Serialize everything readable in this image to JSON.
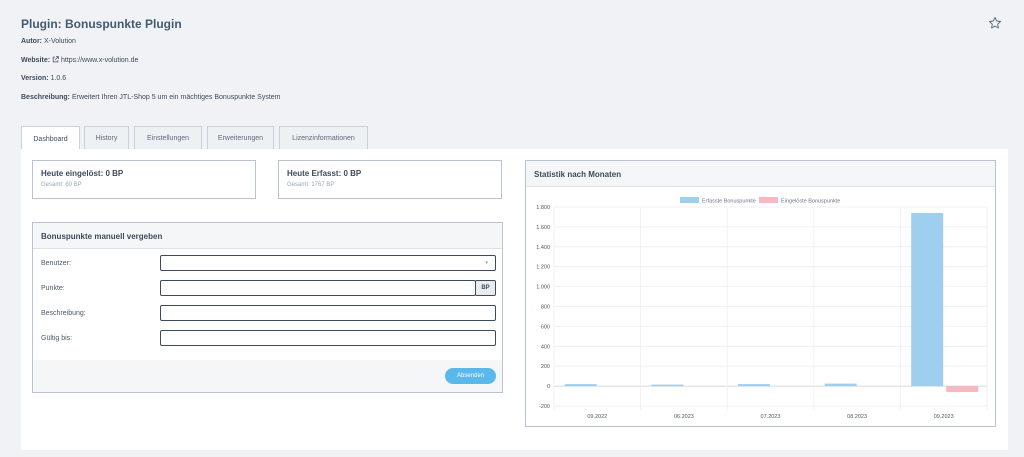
{
  "plugin": {
    "title": "Plugin: Bonuspunkte Plugin",
    "author_label": "Autor:",
    "author_value": "X-Volution",
    "website_label": "Website:",
    "website_value": "https://www.x-volution.de",
    "version_label": "Version:",
    "version_value": "1.0.6",
    "description_label": "Beschreibung:",
    "description_value": "Erweitert Ihren JTL-Shop 5 um ein mächtiges Bonuspunkte System"
  },
  "tabs": [
    {
      "label": "Dashboard",
      "active": true
    },
    {
      "label": "History"
    },
    {
      "label": "Einstellungen"
    },
    {
      "label": "Erweiterungen"
    },
    {
      "label": "Lizenzinformationen"
    }
  ],
  "stats": {
    "redeemed_title": "Heute eingelöst: 0 BP",
    "redeemed_total": "Gesamt: 60 BP",
    "earned_title": "Heute Erfasst: 0 BP",
    "earned_total": "Gesamt: 1767 BP"
  },
  "manual": {
    "title": "Bonuspunkte manuell vergeben",
    "user_label": "Benutzer:",
    "points_label": "Punkte:",
    "points_addon": "BP",
    "description_label": "Beschreibung:",
    "valid_label": "Gültig bis:",
    "submit_label": "Absenden"
  },
  "chart_card": {
    "title": "Statistik nach Monaten"
  },
  "chart_data": {
    "type": "bar",
    "categories": [
      "09.2022",
      "06.2023",
      "07.2023",
      "08.2023",
      "09.2023"
    ],
    "series": [
      {
        "name": "Erfasste Bonuspunkte",
        "values": [
          20,
          5,
          20,
          25,
          1740
        ],
        "color": "#9ecfef"
      },
      {
        "name": "Eingelöste Bonuspunkte",
        "values": [
          0,
          0,
          0,
          0,
          -60
        ],
        "color": "#f7b8c4"
      }
    ],
    "ylim": [
      -200,
      1800
    ],
    "yticks": [
      "1.800",
      "1.600",
      "1.400",
      "1.200",
      "1.000",
      "800",
      "600",
      "400",
      "200",
      "0",
      "-200"
    ],
    "ytick_values": [
      1800,
      1600,
      1400,
      1200,
      1000,
      800,
      600,
      400,
      200,
      0,
      -200
    ],
    "legend": "top",
    "grid": true
  }
}
